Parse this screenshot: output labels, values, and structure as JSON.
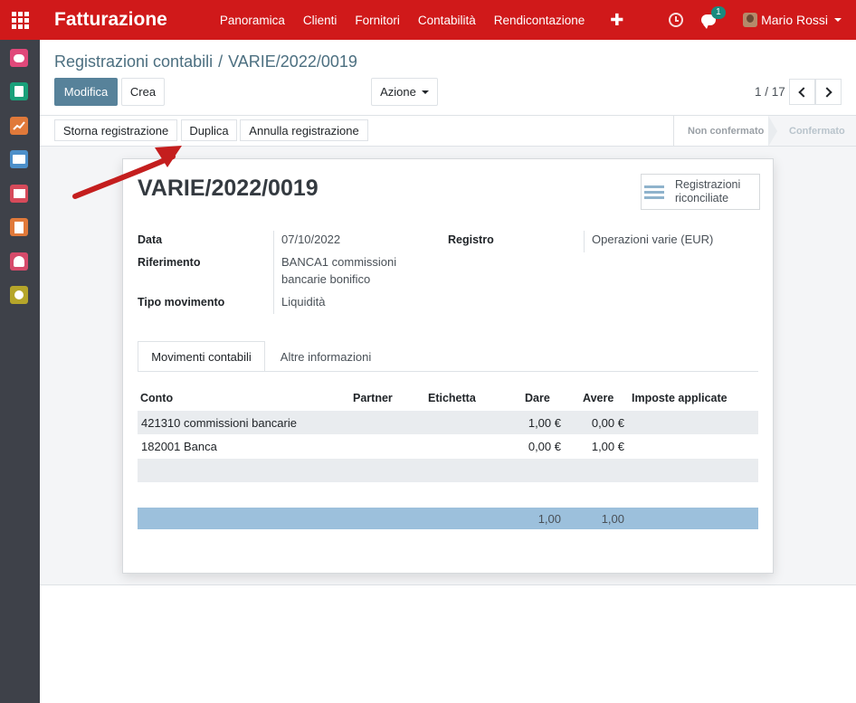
{
  "navbar": {
    "app_title": "Fatturazione",
    "menu": [
      "Panoramica",
      "Clienti",
      "Fornitori",
      "Contabilità",
      "Rendicontazione"
    ],
    "plus": "✚",
    "chat_badge": "1",
    "user_name": "Mario Rossi"
  },
  "sidebar": {
    "apps": [
      {
        "icon": "chat-icon",
        "color": "#e0487a"
      },
      {
        "icon": "contacts-icon",
        "color": "#1aa07a"
      },
      {
        "icon": "chart-icon",
        "color": "#e0793a"
      },
      {
        "icon": "card-icon",
        "color": "#4c8fc9"
      },
      {
        "icon": "box-icon",
        "color": "#d64a5a"
      },
      {
        "icon": "invoice-icon",
        "color": "#e0793a"
      },
      {
        "icon": "dashboard-icon",
        "color": "#d64a6a"
      },
      {
        "icon": "settings-icon",
        "color": "#b5a52a"
      }
    ]
  },
  "control": {
    "breadcrumb_parent": "Registrazioni contabili",
    "breadcrumb_sep": "/",
    "breadcrumb_current": "VARIE/2022/0019",
    "edit_label": "Modifica",
    "create_label": "Crea",
    "action_label": "Azione",
    "pager": "1 / 17"
  },
  "statusbar": {
    "buttons": [
      "Storna registrazione",
      "Duplica",
      "Annulla registrazione"
    ],
    "states": [
      "Non confermato",
      "Confermato"
    ]
  },
  "form": {
    "title": "VARIE/2022/0019",
    "smart_button_line1": "Registrazioni",
    "smart_button_line2": "riconciliate",
    "fields": {
      "data_label": "Data",
      "data_value": "07/10/2022",
      "riferimento_label": "Riferimento",
      "riferimento_line1": "BANCA1 commissioni",
      "riferimento_line2": "bancarie bonifico",
      "tipo_label": "Tipo movimento",
      "tipo_value": "Liquidità",
      "registro_label": "Registro",
      "registro_value": "Operazioni varie (EUR)"
    },
    "tabs": [
      "Movimenti contabili",
      "Altre informazioni"
    ],
    "lines": {
      "headers": [
        "Conto",
        "Partner",
        "Etichetta",
        "Dare",
        "Avere",
        "Imposte applicate"
      ],
      "rows": [
        {
          "conto": "421310 commissioni bancarie",
          "dare": "1,00 €",
          "avere": "0,00 €"
        },
        {
          "conto": "182001 Banca",
          "dare": "0,00 €",
          "avere": "1,00 €"
        }
      ],
      "total_dare": "1,00",
      "total_avere": "1,00"
    }
  },
  "colors": {
    "navbar": "#d0191a",
    "primary": "#57829a",
    "sidebar": "#3e4149",
    "total_row": "#9cc0dc",
    "annotation_arrow": "#c41e1e"
  }
}
